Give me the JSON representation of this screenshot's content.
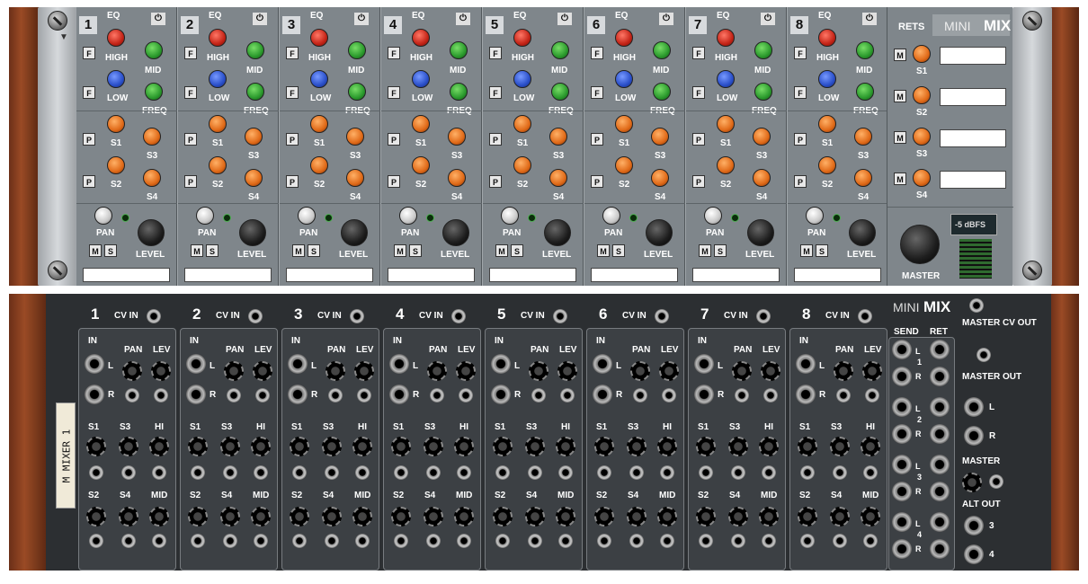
{
  "front": {
    "brand_mini": "MINI",
    "brand_mix": "MIX",
    "rets_title": "RETS",
    "channels": [
      {
        "num": "1",
        "eq": "EQ",
        "high": "HIGH",
        "low": "LOW",
        "mid": "MID",
        "freq": "FREQ",
        "s1": "S1",
        "s2": "S2",
        "s3": "S3",
        "s4": "S4",
        "pan": "PAN",
        "level": "LEVEL",
        "f": "F",
        "p": "P",
        "m": "M",
        "s": "S"
      },
      {
        "num": "2",
        "eq": "EQ",
        "high": "HIGH",
        "low": "LOW",
        "mid": "MID",
        "freq": "FREQ",
        "s1": "S1",
        "s2": "S2",
        "s3": "S3",
        "s4": "S4",
        "pan": "PAN",
        "level": "LEVEL",
        "f": "F",
        "p": "P",
        "m": "M",
        "s": "S"
      },
      {
        "num": "3",
        "eq": "EQ",
        "high": "HIGH",
        "low": "LOW",
        "mid": "MID",
        "freq": "FREQ",
        "s1": "S1",
        "s2": "S2",
        "s3": "S3",
        "s4": "S4",
        "pan": "PAN",
        "level": "LEVEL",
        "f": "F",
        "p": "P",
        "m": "M",
        "s": "S"
      },
      {
        "num": "4",
        "eq": "EQ",
        "high": "HIGH",
        "low": "LOW",
        "mid": "MID",
        "freq": "FREQ",
        "s1": "S1",
        "s2": "S2",
        "s3": "S3",
        "s4": "S4",
        "pan": "PAN",
        "level": "LEVEL",
        "f": "F",
        "p": "P",
        "m": "M",
        "s": "S"
      },
      {
        "num": "5",
        "eq": "EQ",
        "high": "HIGH",
        "low": "LOW",
        "mid": "MID",
        "freq": "FREQ",
        "s1": "S1",
        "s2": "S2",
        "s3": "S3",
        "s4": "S4",
        "pan": "PAN",
        "level": "LEVEL",
        "f": "F",
        "p": "P",
        "m": "M",
        "s": "S"
      },
      {
        "num": "6",
        "eq": "EQ",
        "high": "HIGH",
        "low": "LOW",
        "mid": "MID",
        "freq": "FREQ",
        "s1": "S1",
        "s2": "S2",
        "s3": "S3",
        "s4": "S4",
        "pan": "PAN",
        "level": "LEVEL",
        "f": "F",
        "p": "P",
        "m": "M",
        "s": "S"
      },
      {
        "num": "7",
        "eq": "EQ",
        "high": "HIGH",
        "low": "LOW",
        "mid": "MID",
        "freq": "FREQ",
        "s1": "S1",
        "s2": "S2",
        "s3": "S3",
        "s4": "S4",
        "pan": "PAN",
        "level": "LEVEL",
        "f": "F",
        "p": "P",
        "m": "M",
        "s": "S"
      },
      {
        "num": "8",
        "eq": "EQ",
        "high": "HIGH",
        "low": "LOW",
        "mid": "MID",
        "freq": "FREQ",
        "s1": "S1",
        "s2": "S2",
        "s3": "S3",
        "s4": "S4",
        "pan": "PAN",
        "level": "LEVEL",
        "f": "F",
        "p": "P",
        "m": "M",
        "s": "S"
      }
    ],
    "returns": [
      {
        "m": "M",
        "label": "S1"
      },
      {
        "m": "M",
        "label": "S2"
      },
      {
        "m": "M",
        "label": "S3"
      },
      {
        "m": "M",
        "label": "S4"
      }
    ],
    "meter_label": "-5 dBFS",
    "master": "MASTER"
  },
  "back": {
    "brand_mini": "MINI",
    "brand_mix": "MIX",
    "device_tag": "M MIXER 1",
    "cv_in": "CV IN",
    "in": "IN",
    "pan": "PAN",
    "lev": "LEV",
    "l": "L",
    "r": "R",
    "s1": "S1",
    "s3": "S3",
    "hi": "HI",
    "s2": "S2",
    "s4": "S4",
    "mid": "MID",
    "send": "SEND",
    "ret": "RET",
    "ret_nums": [
      "1",
      "2",
      "3",
      "4"
    ],
    "master_cv_out": "MASTER CV OUT",
    "master_out": "MASTER OUT",
    "master": "MASTER",
    "alt_out": "ALT OUT",
    "alt_nums": [
      "3",
      "4"
    ]
  }
}
